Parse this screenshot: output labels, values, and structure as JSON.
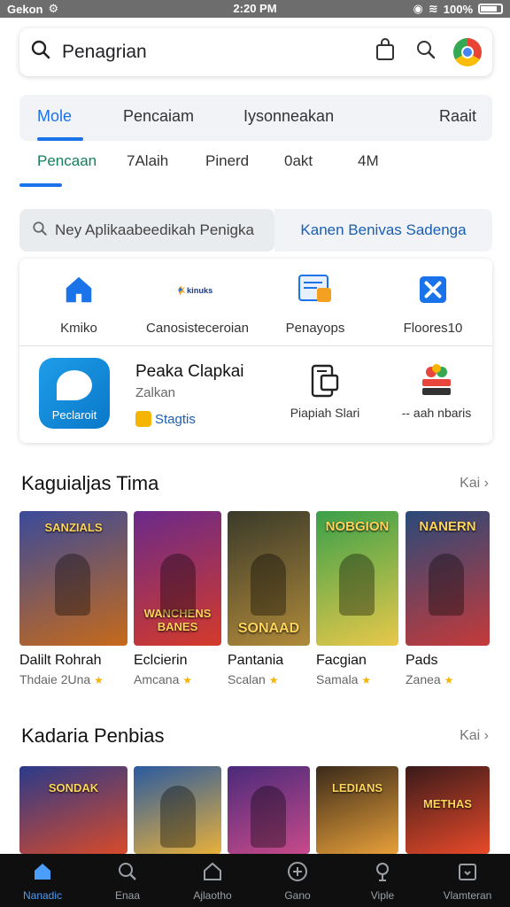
{
  "status_bar": {
    "carrier": "Gekon",
    "time": "2:20 PM",
    "battery": "100%"
  },
  "search": {
    "query": "Penagrian"
  },
  "tabs": {
    "items": [
      "Mole",
      "Pencaiam",
      "Iysonneakan",
      "Raait"
    ],
    "active": 0
  },
  "subtabs": {
    "items": [
      "Pencaan",
      "7Alaih",
      "Pinerd",
      "0akt",
      "4M"
    ],
    "active": 0
  },
  "secondary_search": {
    "placeholder": "Ney Aplikaabeedikah Penigka",
    "link": "Kanen Benivas Sadenga"
  },
  "quick_actions": [
    {
      "label": "Kmiko",
      "icon": "home-icon"
    },
    {
      "label": "Canosisteceroian",
      "icon": "kinuks-logo-icon"
    },
    {
      "label": "Penayops",
      "icon": "document-icon"
    },
    {
      "label": "Floores10",
      "icon": "close-square-icon"
    }
  ],
  "featured_app": {
    "icon_text": "Peclaroit",
    "title": "Peaka Clapkai",
    "subtitle": "Zalkan",
    "tag": "Stagtis"
  },
  "mini_actions": [
    {
      "label": "Piapiah Slari",
      "icon": "server-icon"
    },
    {
      "label": "-- aah nbaris",
      "icon": "stack-icon"
    }
  ],
  "section1": {
    "title": "Kaguialjas Tima",
    "more": "Kai",
    "games": [
      {
        "art_title": "SANZIALS",
        "name": "Dalilt Rohrah",
        "meta": "Thdaie 2Una",
        "colors": [
          "#3a4a9a",
          "#c66a1a"
        ]
      },
      {
        "art_title": "WANCHENS BANES",
        "name": "Eclcierin",
        "meta": "Amcana",
        "colors": [
          "#6a2a8a",
          "#d43a2a"
        ]
      },
      {
        "art_title": "SONAAD",
        "name": "Pantania",
        "meta": "Scalan",
        "colors": [
          "#3a3a2a",
          "#b08a3a"
        ]
      },
      {
        "art_title": "NOBGION",
        "name": "Facgian",
        "meta": "Samala",
        "colors": [
          "#3aa04a",
          "#e8c84a"
        ]
      },
      {
        "art_title": "NANERN",
        "name": "Pads",
        "meta": "Zanea",
        "colors": [
          "#2a4a7a",
          "#c43a3a"
        ]
      }
    ]
  },
  "section2": {
    "title": "Kadaria Penbias",
    "more": "Kai",
    "games": [
      {
        "art_title": "SONDAK",
        "colors": [
          "#2a3a8a",
          "#d84a2a"
        ]
      },
      {
        "art_title": "",
        "colors": [
          "#2a5aa0",
          "#e8b03a"
        ]
      },
      {
        "art_title": "",
        "colors": [
          "#4a2a7a",
          "#c84a8a"
        ]
      },
      {
        "art_title": "LEDIANS",
        "colors": [
          "#3a2a1a",
          "#e8a03a"
        ]
      },
      {
        "art_title": "METHAS",
        "colors": [
          "#3a1a1a",
          "#e84a2a"
        ]
      }
    ]
  },
  "bottom_nav": {
    "active": 0,
    "items": [
      {
        "label": "Nanadic",
        "icon": "home-icon"
      },
      {
        "label": "Enaa",
        "icon": "search-icon"
      },
      {
        "label": "Ajlaotho",
        "icon": "apps-icon"
      },
      {
        "label": "Gano",
        "icon": "plus-circle-icon"
      },
      {
        "label": "Viple",
        "icon": "pin-icon"
      },
      {
        "label": "Vlamteran",
        "icon": "inbox-icon"
      }
    ]
  }
}
